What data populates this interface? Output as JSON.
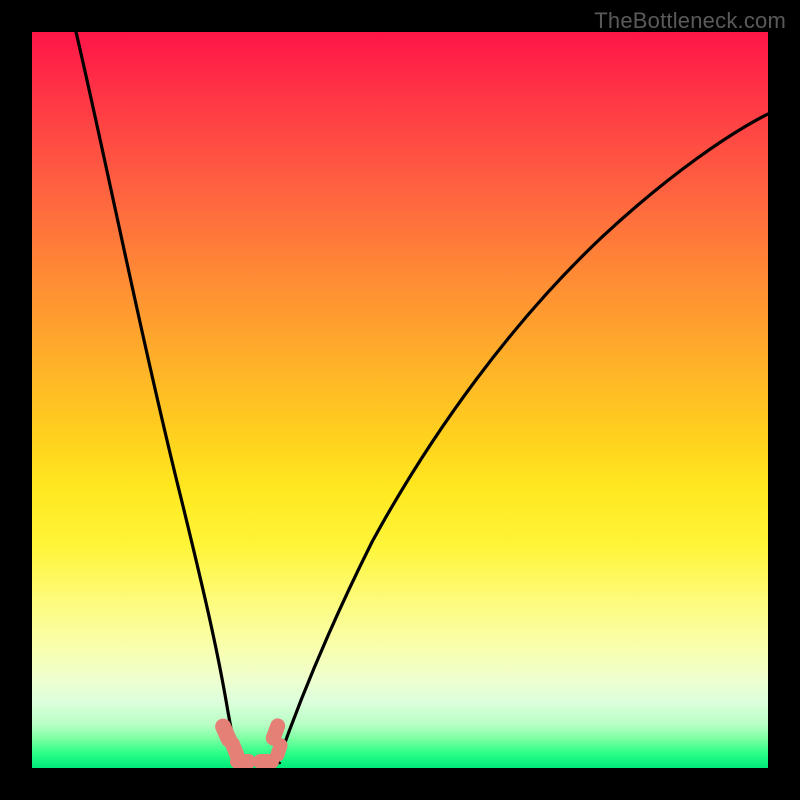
{
  "watermark": "TheBottleneck.com",
  "chart_data": {
    "type": "line",
    "title": "",
    "xlabel": "",
    "ylabel": "",
    "xlim": [
      0,
      100
    ],
    "ylim": [
      0,
      100
    ],
    "annotations": [],
    "series": [
      {
        "name": "left-curve",
        "x": [
          6,
          8,
          10,
          12,
          14,
          16,
          18,
          20,
          22,
          24,
          25,
          26,
          26.5,
          27
        ],
        "values": [
          100,
          90,
          80,
          69,
          58,
          46,
          35,
          25,
          16,
          9,
          6,
          4,
          2.5,
          1
        ]
      },
      {
        "name": "right-curve",
        "x": [
          33,
          34,
          36,
          38,
          41,
          45,
          50,
          56,
          63,
          71,
          80,
          90,
          99
        ],
        "values": [
          1,
          3,
          7,
          12,
          20,
          29,
          38,
          47,
          55,
          63,
          70,
          77,
          82
        ]
      },
      {
        "name": "baseline",
        "x": [
          26,
          28,
          30,
          32,
          34
        ],
        "values": [
          0.5,
          0.3,
          0.2,
          0.3,
          0.5
        ]
      }
    ],
    "markers": [
      {
        "name": "left-lower",
        "cx": 26.0,
        "cy": 4.5,
        "w": 2.0,
        "h": 4.0,
        "angle": -65
      },
      {
        "name": "left-upper",
        "cx": 27.0,
        "cy": 2.2,
        "w": 2.0,
        "h": 3.5,
        "angle": -60
      },
      {
        "name": "right-upper",
        "cx": 33.0,
        "cy": 4.5,
        "w": 2.0,
        "h": 3.8,
        "angle": 62
      },
      {
        "name": "right-lower",
        "cx": 33.5,
        "cy": 2.0,
        "w": 2.0,
        "h": 3.3,
        "angle": 55
      },
      {
        "name": "bottom-left",
        "cx": 28.5,
        "cy": 0.8,
        "w": 3.2,
        "h": 2.0,
        "angle": 0
      },
      {
        "name": "bottom-right",
        "cx": 31.5,
        "cy": 0.8,
        "w": 3.2,
        "h": 2.0,
        "angle": 0
      }
    ],
    "background_gradient": {
      "top": "#ff1548",
      "mid": "#ffe81f",
      "bottom": "#00e97a"
    }
  }
}
